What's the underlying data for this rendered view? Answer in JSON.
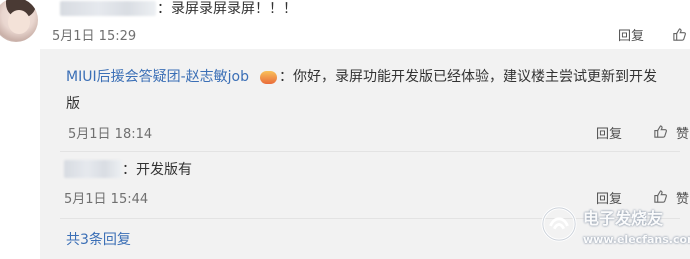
{
  "comment": {
    "text": "：录屏录屏录屏！！！",
    "date": "5月1日 15:29",
    "reply_label": "回复"
  },
  "replies": [
    {
      "username": "MIUI后援会答疑团-赵志敏job",
      "text_line1": "：你好，录屏功能开发版已经体验，建议楼主尝试更新到开发",
      "text_line2": "版",
      "date": "5月1日 18:14",
      "reply_label": "回复",
      "like_label": "赞"
    },
    {
      "text": "：开发版有",
      "date": "5月1日 15:44",
      "reply_label": "回复",
      "like_label": "赞"
    }
  ],
  "footer": {
    "total_replies": "共3条回复"
  },
  "watermark": {
    "title": "电子发烧友",
    "url": "www.elecfans.com"
  },
  "colors": {
    "link": "#3b6fb6",
    "panel_bg": "#f2f2f2"
  },
  "icons": [
    "avatar",
    "vip-badge-icon",
    "thumbs-up-icon",
    "elecfans-logo-icon"
  ]
}
